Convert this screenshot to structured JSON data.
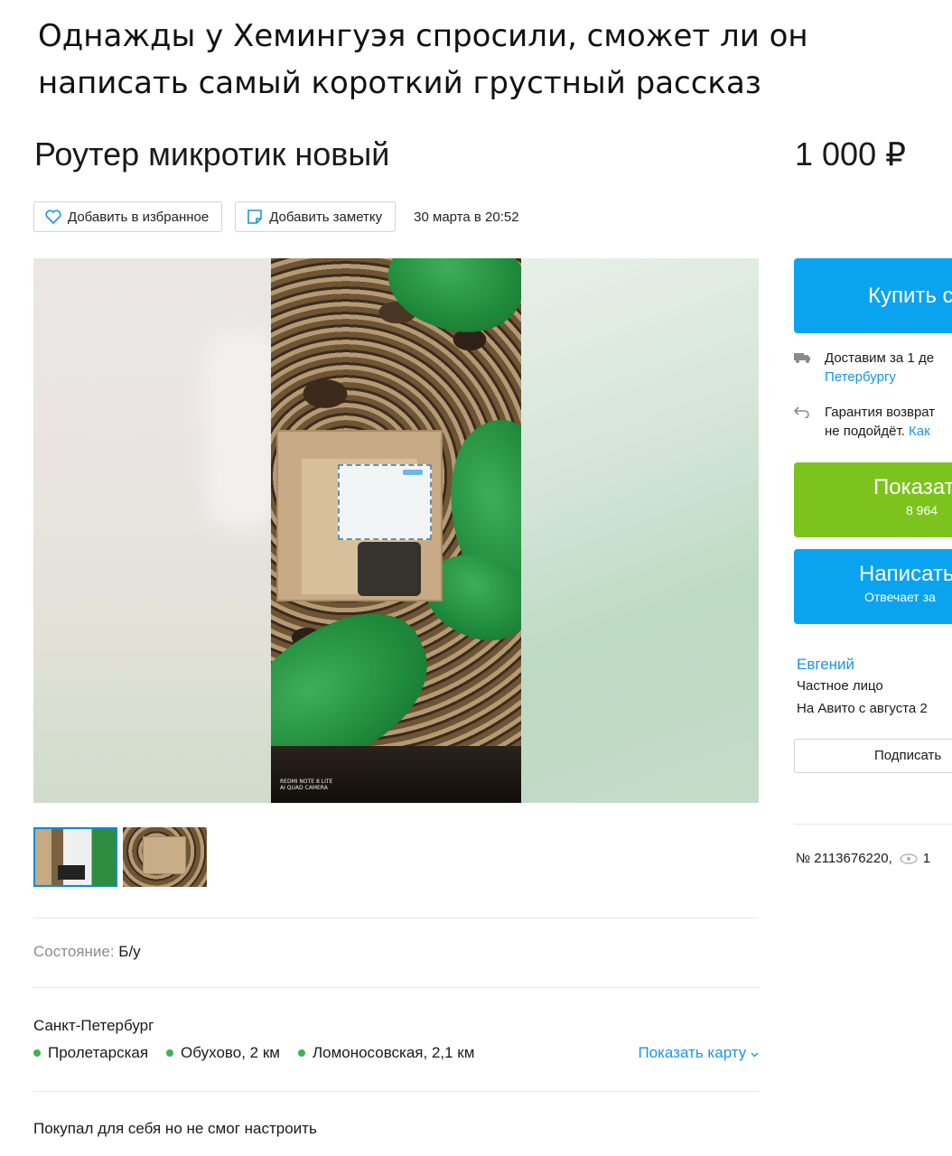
{
  "meme": {
    "caption_line1": "Однажды у Хемингуэя спросили, сможет ли он",
    "caption_line2": "написать самый короткий грустный рассказ"
  },
  "listing": {
    "title": "Роутер микротик новый",
    "price": "1 000 ₽",
    "actions": {
      "favorite_label": "Добавить в избранное",
      "note_label": "Добавить заметку",
      "date": "30 марта в 20:52"
    },
    "gallery": {
      "watermark_line1": "REDMI NOTE 8 LITE",
      "watermark_line2": "AI QUAD CAMERA",
      "thumbnails": [
        "photo-1",
        "photo-2"
      ],
      "active_thumbnail": 1
    },
    "condition": {
      "label": "Состояние:",
      "value": "Б/у"
    },
    "location": {
      "city": "Санкт-Петербург",
      "metro": [
        "Пролетарская",
        "Обухово, 2 км",
        "Ломоносовская, 2,1 км"
      ],
      "metro_color": "#3cb54a",
      "show_map": "Показать карту"
    },
    "description": "Покупал для себя но не смог настроить"
  },
  "sidebar": {
    "buy_label": "Купить с",
    "delivery_line1": "Доставим за 1 де",
    "delivery_line2": "Петербургу",
    "guarantee_line1": "Гарантия возврат",
    "guarantee_line2_text": "не подойдёт.",
    "guarantee_line2_link": "Как",
    "phone_label": "Показат",
    "phone_partial": "8 964",
    "message_label": "Написать",
    "message_sub": "Отвечает за",
    "seller_name": "Евгений",
    "seller_type": "Частное лицо",
    "seller_since": "На Авито с августа 2",
    "subscribe_label": "Подписать",
    "ad_number": "№ 2113676220,",
    "views_partial": "1"
  },
  "colors": {
    "accent_blue": "#0aa3f0",
    "link_blue": "#1a94e5",
    "phone_green": "#7cc41d"
  }
}
